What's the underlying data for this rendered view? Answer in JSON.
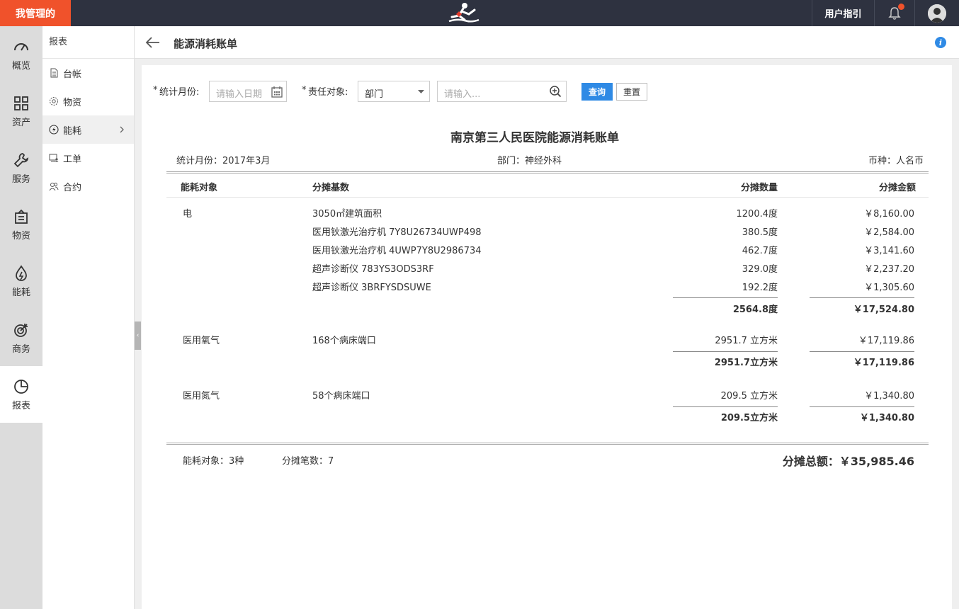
{
  "topbar": {
    "brand": "我管理的",
    "guide": "用户指引"
  },
  "rail": [
    {
      "label": "概览",
      "icon": "gauge-icon"
    },
    {
      "label": "资产",
      "icon": "grid-icon"
    },
    {
      "label": "服务",
      "icon": "wrench-icon"
    },
    {
      "label": "物资",
      "icon": "box-icon"
    },
    {
      "label": "能耗",
      "icon": "flame-icon"
    },
    {
      "label": "商务",
      "icon": "target-icon"
    },
    {
      "label": "报表",
      "icon": "pie-chart-icon",
      "active": true
    }
  ],
  "subnav": {
    "title": "报表",
    "items": [
      {
        "label": "台帐",
        "icon": "document-icon"
      },
      {
        "label": "物资",
        "icon": "gear-icon"
      },
      {
        "label": "能耗",
        "icon": "lightning-icon",
        "active": true
      },
      {
        "label": "工单",
        "icon": "monitor-user-icon"
      },
      {
        "label": "合约",
        "icon": "users-icon"
      }
    ]
  },
  "header": {
    "title": "能源消耗账单"
  },
  "filters": {
    "month_label": "统计月份:",
    "month_placeholder": "请输入日期",
    "target_label": "责任对象:",
    "target_value": "部门",
    "search_placeholder": "请输入...",
    "query_button": "查询",
    "reset_button": "重置",
    "required_mark": "*"
  },
  "report": {
    "title": "南京第三人民医院能源消耗账单",
    "month": "统计月份：2017年3月",
    "department": "部门：神经外科",
    "currency": "币种：人名币",
    "columns": [
      "能耗对象",
      "分摊基数",
      "分摊数量",
      "分摊金额"
    ],
    "groups": [
      {
        "name": "电",
        "rows": [
          {
            "base": "3050㎡建筑面积",
            "qty": "1200.4度",
            "amount": "￥8,160.00"
          },
          {
            "base": "医用钬激光治疗机 7Y8U26734UWP498",
            "qty": "380.5度",
            "amount": "￥2,584.00"
          },
          {
            "base": "医用钬激光治疗机 4UWP7Y8U2986734",
            "qty": "462.7度",
            "amount": "￥3,141.60"
          },
          {
            "base": "超声诊断仪 783YS3ODS3RF",
            "qty": "329.0度",
            "amount": "￥2,237.20"
          },
          {
            "base": "超声诊断仪 3BRFYSDSUWE",
            "qty": "192.2度",
            "amount": "￥1,305.60"
          }
        ],
        "subtotal_qty": "2564.8度",
        "subtotal_amount": "￥17,524.80"
      },
      {
        "name": "医用氧气",
        "rows": [
          {
            "base": "168个病床端口",
            "qty": "2951.7 立方米",
            "amount": "￥17,119.86"
          }
        ],
        "subtotal_qty": "2951.7立方米",
        "subtotal_amount": "￥17,119.86"
      },
      {
        "name": "医用氮气",
        "rows": [
          {
            "base": "58个病床端口",
            "qty": "209.5 立方米",
            "amount": "￥1,340.80"
          }
        ],
        "subtotal_qty": "209.5立方米",
        "subtotal_amount": "￥1,340.80"
      }
    ],
    "summary_objects": "能耗对象：3种",
    "summary_count": "分摊笔数：7",
    "grand_total": "分摊总额：￥35,985.46"
  }
}
